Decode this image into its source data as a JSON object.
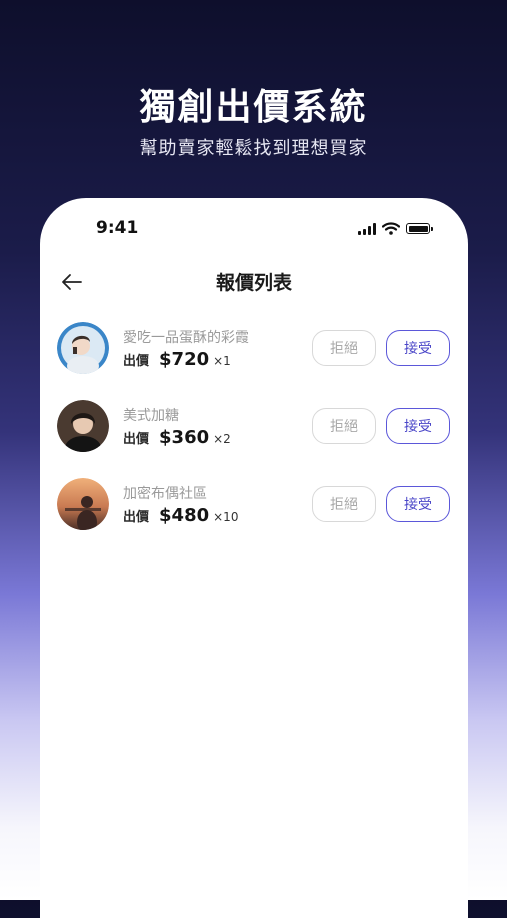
{
  "hero": {
    "title": "獨創出價系統",
    "subtitle": "幫助賣家輕鬆找到理想買家"
  },
  "status_bar": {
    "time": "9:41",
    "icons": [
      "signal-icon",
      "wifi-icon",
      "battery-icon"
    ]
  },
  "nav": {
    "back_icon": "arrow-left-icon",
    "title": "報價列表"
  },
  "offers": [
    {
      "name": "愛吃一品蛋酥的彩霞",
      "bid_label": "出價",
      "price": "$720",
      "quantity": "×1",
      "reject_label": "拒絕",
      "accept_label": "接受"
    },
    {
      "name": "美式加糖",
      "bid_label": "出價",
      "price": "$360",
      "quantity": "×2",
      "reject_label": "拒絕",
      "accept_label": "接受"
    },
    {
      "name": "加密布偶社區",
      "bid_label": "出價",
      "price": "$480",
      "quantity": "×10",
      "reject_label": "拒絕",
      "accept_label": "接受"
    }
  ],
  "colors": {
    "accent": "#5b57d9",
    "background_top": "#0e0f2c",
    "background_bottom": "#ffffff"
  }
}
